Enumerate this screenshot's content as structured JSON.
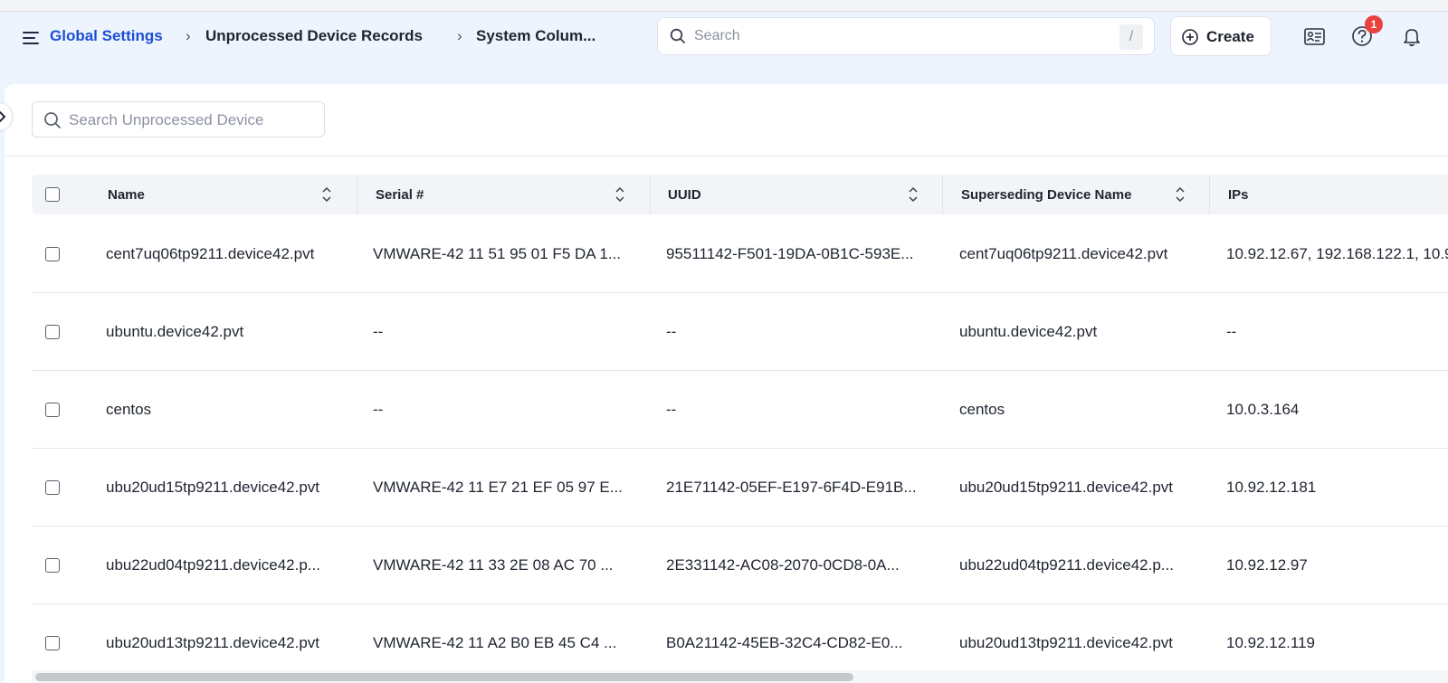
{
  "breadcrumb": {
    "items": [
      {
        "label": "Global Settings"
      },
      {
        "label": "Unprocessed Device Records"
      },
      {
        "label": "System Colum..."
      }
    ],
    "separator": "›"
  },
  "global_search": {
    "placeholder": "Search",
    "shortcut": "/"
  },
  "create_button": {
    "label": "Create"
  },
  "help_badge": {
    "count": "1"
  },
  "icons": [
    "menu-icon",
    "search-icon",
    "plus-circle-icon",
    "contact-card-icon",
    "help-icon",
    "bell-icon",
    "chevron-right-icon",
    "sort-icon"
  ],
  "colors": {
    "link": "#1c4fd8",
    "badge": "#e8413e",
    "header_bg": "#eef4fd"
  },
  "local_search": {
    "placeholder": "Search Unprocessed Device"
  },
  "table": {
    "columns": [
      "Name",
      "Serial #",
      "UUID",
      "Superseding Device Name",
      "IPs"
    ],
    "rows": [
      [
        "cent7uq06tp9211.device42.pvt",
        "VMWARE-42 11 51 95 01 F5 DA 1...",
        "95511142-F501-19DA-0B1C-593E...",
        "cent7uq06tp9211.device42.pvt",
        "10.92.12.67, 192.168.122.1, 10.9"
      ],
      [
        "ubuntu.device42.pvt",
        "--",
        "--",
        "ubuntu.device42.pvt",
        "--"
      ],
      [
        "centos",
        "--",
        "--",
        "centos",
        "10.0.3.164"
      ],
      [
        "ubu20ud15tp9211.device42.pvt",
        "VMWARE-42 11 E7 21 EF 05 97 E...",
        "21E71142-05EF-E197-6F4D-E91B...",
        "ubu20ud15tp9211.device42.pvt",
        "10.92.12.181"
      ],
      [
        "ubu22ud04tp9211.device42.p...",
        "VMWARE-42 11 33 2E 08 AC 70 ...",
        "2E331142-AC08-2070-0CD8-0A...",
        "ubu22ud04tp9211.device42.p...",
        "10.92.12.97"
      ],
      [
        "ubu20ud13tp9211.device42.pvt",
        "VMWARE-42 11 A2 B0 EB 45 C4 ...",
        "B0A21142-45EB-32C4-CD82-E0...",
        "ubu20ud13tp9211.device42.pvt",
        "10.92.12.119"
      ]
    ]
  }
}
